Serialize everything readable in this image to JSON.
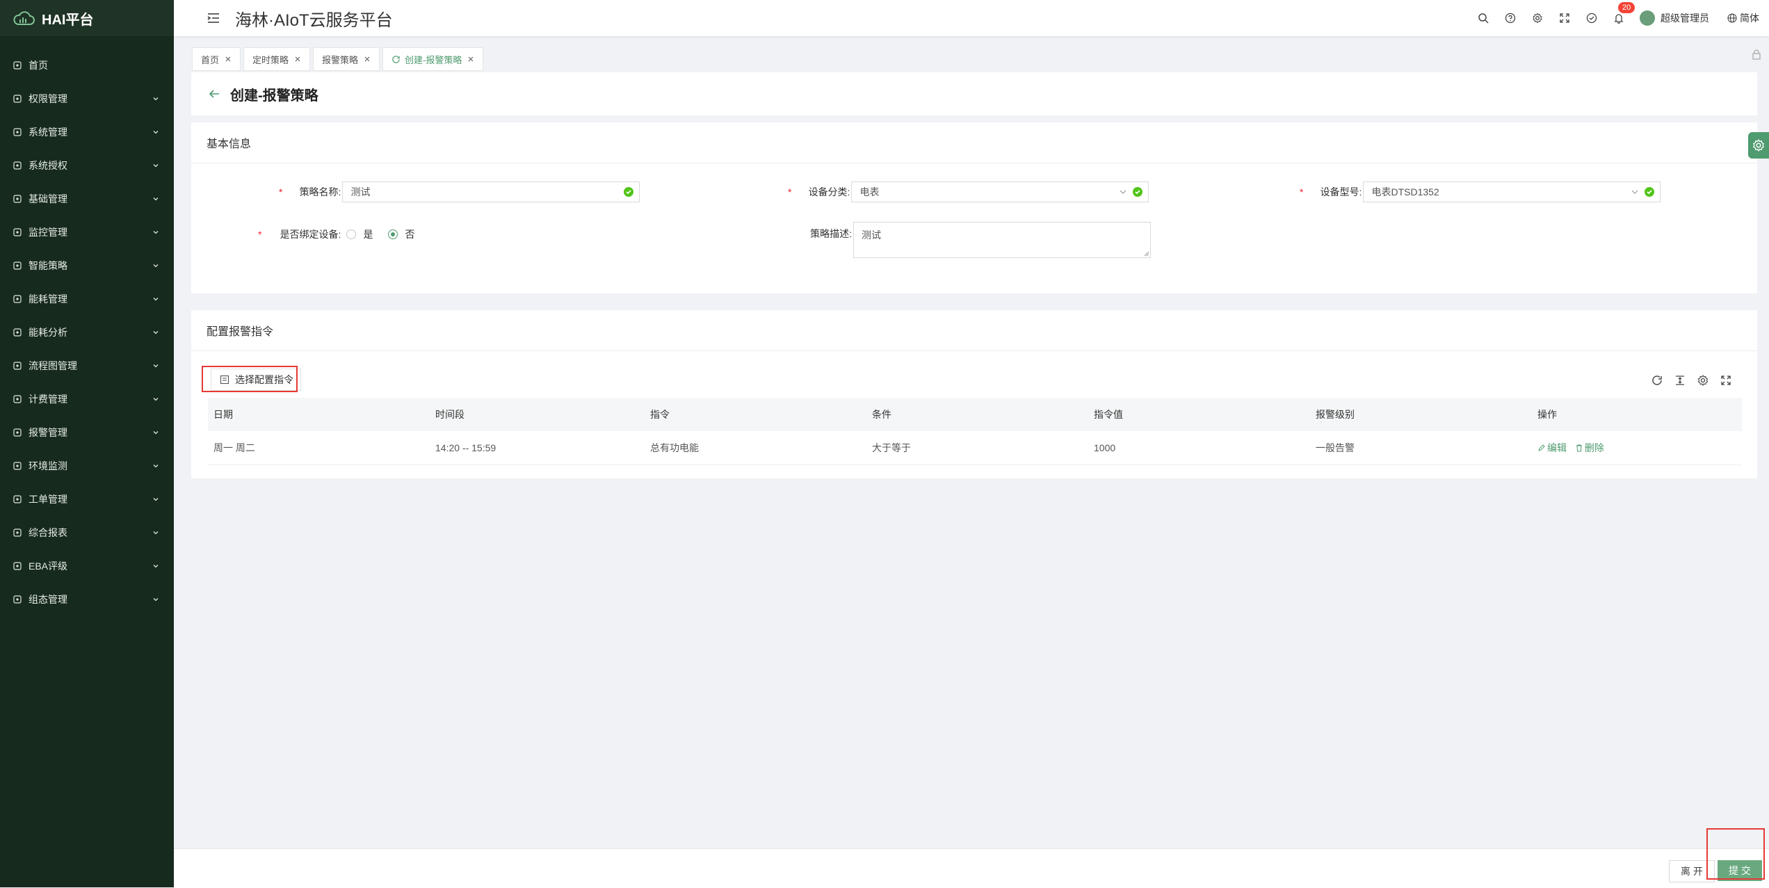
{
  "brand": {
    "title": "HAI平台"
  },
  "sidebar": {
    "items": [
      {
        "label": "首页",
        "icon": "dashboard-icon",
        "expandable": false
      },
      {
        "label": "权限管理",
        "icon": "shield-icon",
        "expandable": true
      },
      {
        "label": "系统管理",
        "icon": "monitor-icon",
        "expandable": true
      },
      {
        "label": "系统授权",
        "icon": "license-icon",
        "expandable": true
      },
      {
        "label": "基础管理",
        "icon": "database-icon",
        "expandable": true
      },
      {
        "label": "监控管理",
        "icon": "camera-icon",
        "expandable": true
      },
      {
        "label": "智能策略",
        "icon": "bulb-icon",
        "expandable": true
      },
      {
        "label": "能耗管理",
        "icon": "sliders-icon",
        "expandable": true
      },
      {
        "label": "能耗分析",
        "icon": "bar-chart-icon",
        "expandable": true
      },
      {
        "label": "流程图管理",
        "icon": "flow-icon",
        "expandable": true
      },
      {
        "label": "计费管理",
        "icon": "billing-icon",
        "expandable": true
      },
      {
        "label": "报警管理",
        "icon": "alarm-icon",
        "expandable": true
      },
      {
        "label": "环境监测",
        "icon": "leaf-icon",
        "expandable": true
      },
      {
        "label": "工单管理",
        "icon": "layers-icon",
        "expandable": true
      },
      {
        "label": "综合报表",
        "icon": "report-icon",
        "expandable": true
      },
      {
        "label": "EBA评级",
        "icon": "rating-icon",
        "expandable": true
      },
      {
        "label": "组态管理",
        "icon": "config-icon",
        "expandable": true
      }
    ]
  },
  "header": {
    "title": "海林·AIoT云服务平台",
    "notification_count": "20",
    "username": "超级管理员",
    "language": "简体"
  },
  "tabs": [
    {
      "label": "首页",
      "active": false
    },
    {
      "label": "定时策略",
      "active": false
    },
    {
      "label": "报警策略",
      "active": false
    },
    {
      "label": "创建-报警策略",
      "active": true
    }
  ],
  "page": {
    "title": "创建-报警策略"
  },
  "basic": {
    "section_title": "基本信息",
    "strategy_name": {
      "label": "策略名称:",
      "value": "测试"
    },
    "device_category": {
      "label": "设备分类:",
      "value": "电表"
    },
    "device_model": {
      "label": "设备型号:",
      "value": "电表DTSD1352"
    },
    "bind_device": {
      "label": "是否绑定设备:",
      "options": [
        "是",
        "否"
      ],
      "selected": "否"
    },
    "description": {
      "label": "策略描述:",
      "value": "测试"
    }
  },
  "config": {
    "section_title": "配置报警指令",
    "select_button": "选择配置指令",
    "columns": [
      "日期",
      "时间段",
      "指令",
      "条件",
      "指令值",
      "报警级别",
      "操作"
    ],
    "rows": [
      {
        "date": "周一 周二",
        "time": "14:20 -- 15:59",
        "command": "总有功电能",
        "condition": "大于等于",
        "value": "1000",
        "level": "一般告警",
        "edit": "编辑",
        "delete": "删除"
      }
    ]
  },
  "footer": {
    "leave": "离 开",
    "submit": "提 交"
  },
  "colors": {
    "sidebar_bg": "#172a1e",
    "accent": "#4e9b6f",
    "submit_bg": "#6aa97f",
    "highlight": "#e53935"
  }
}
